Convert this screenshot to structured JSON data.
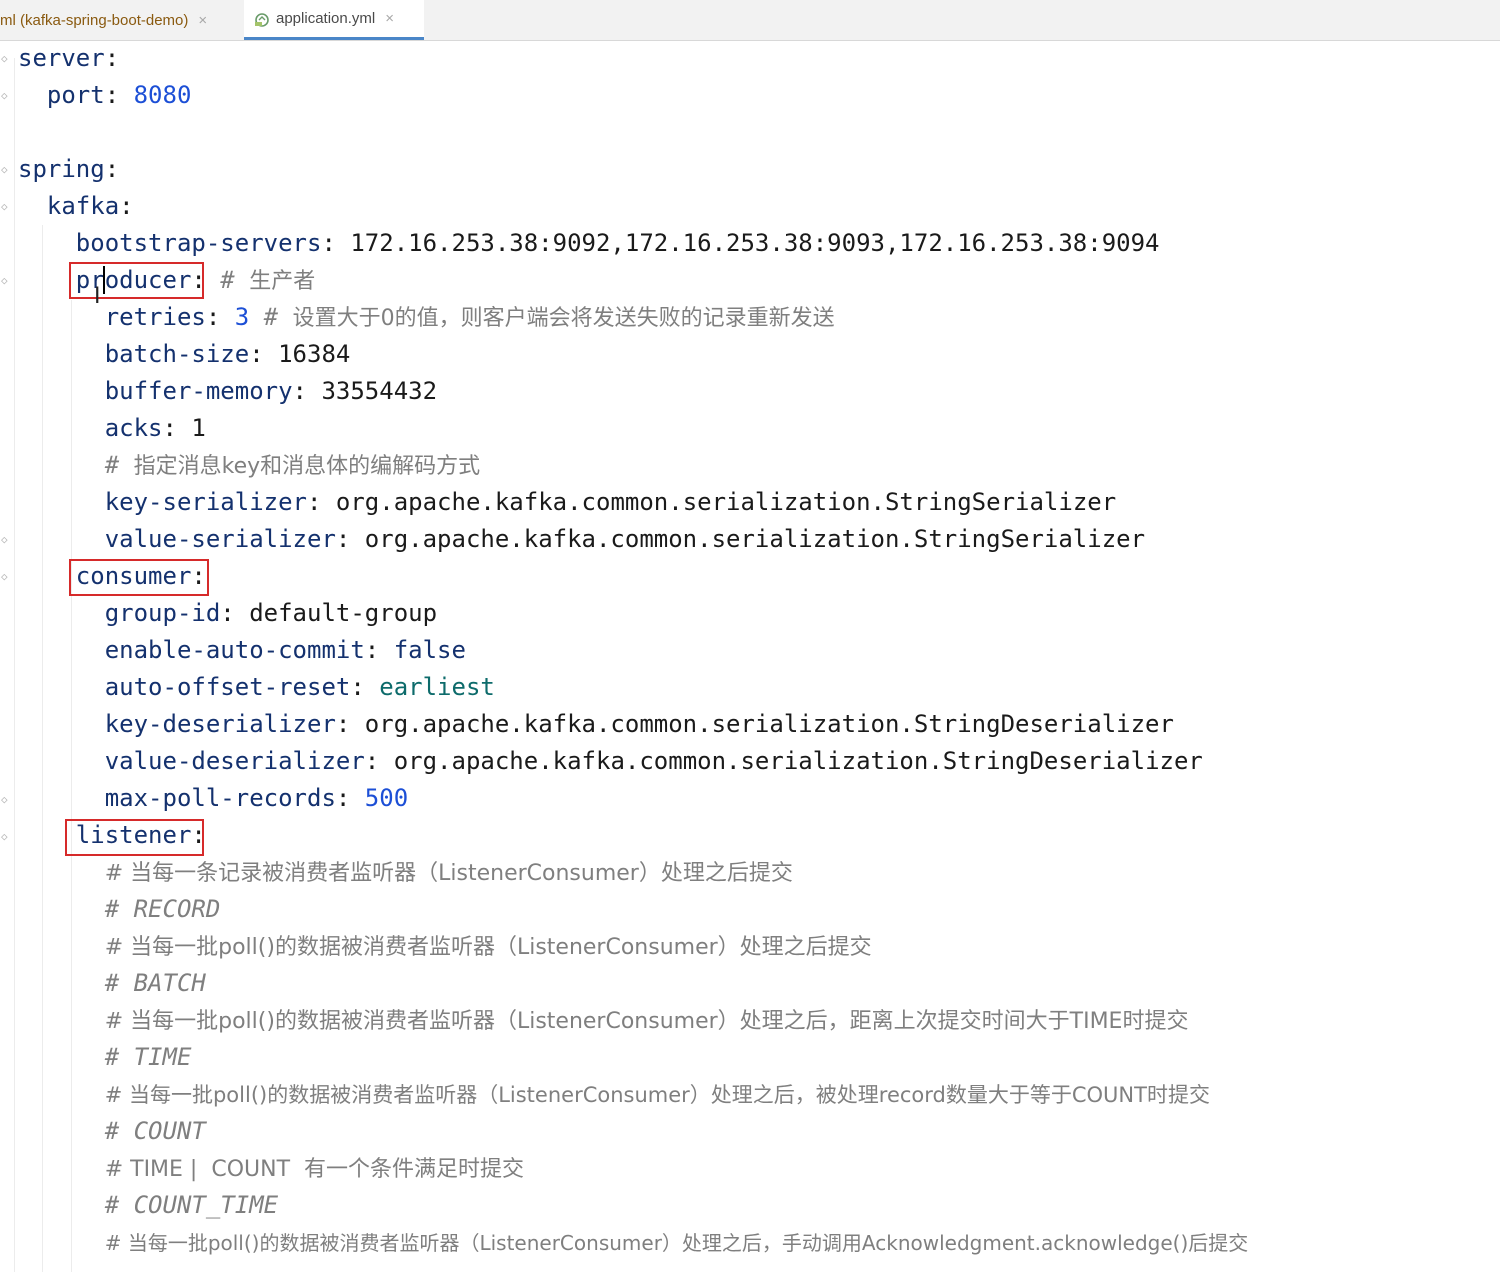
{
  "tabs": [
    {
      "label": "ml (kafka-spring-boot-demo)",
      "close": "×"
    },
    {
      "label": "application.yml",
      "close": "×"
    }
  ],
  "lines": {
    "server_key": "server",
    "colon": ":",
    "port_key": "port",
    "port_val": "8080",
    "spring_key": "spring",
    "kafka_key": "kafka",
    "bootstrap_key": "bootstrap-servers",
    "bootstrap_val": "172.16.253.38:9092,172.16.253.38:9093,172.16.253.38:9094",
    "producer_key": "producer",
    "producer_cmt_hash": "# ",
    "producer_cmt": "生产者",
    "retries_key": "retries",
    "retries_val": "3",
    "retries_cmt_hash": "# ",
    "retries_cmt": "设置大于0的值，则客户端会将发送失败的记录重新发送",
    "batch_key": "batch-size",
    "batch_val": "16384",
    "buffer_key": "buffer-memory",
    "buffer_val": "33554432",
    "acks_key": "acks",
    "acks_val": "1",
    "serializer_cmt_hash": "# ",
    "serializer_cmt": "指定消息key和消息体的编解码方式",
    "keyser_key": "key-serializer",
    "keyser_val": "org.apache.kafka.common.serialization.StringSerializer",
    "valser_key": "value-serializer",
    "valser_val": "org.apache.kafka.common.serialization.StringSerializer",
    "consumer_key": "consumer",
    "group_key": "group-id",
    "group_val": "default-group",
    "autocommit_key": "enable-auto-commit",
    "autocommit_val": "false",
    "offset_key": "auto-offset-reset",
    "offset_val": "earliest",
    "keydeser_key": "key-deserializer",
    "keydeser_val": "org.apache.kafka.common.serialization.StringDeserializer",
    "valdeser_key": "value-deserializer",
    "valdeser_val": "org.apache.kafka.common.serialization.StringDeserializer",
    "maxpoll_key": "max-poll-records",
    "maxpoll_val": "500",
    "listener_key": "listener",
    "c1": "# 当每一条记录被消费者监听器（ListenerConsumer）处理之后提交",
    "c2": "# RECORD",
    "c3": "# 当每一批poll()的数据被消费者监听器（ListenerConsumer）处理之后提交",
    "c4": "# BATCH",
    "c5": "# 当每一批poll()的数据被消费者监听器（ListenerConsumer）处理之后，距离上次提交时间大于TIME时提交",
    "c6": "# TIME",
    "c7": "# 当每一批poll()的数据被消费者监听器（ListenerConsumer）处理之后，被处理record数量大于等于COUNT时提交",
    "c8": "# COUNT",
    "c9": "# TIME |  COUNT  有一个条件满足时提交",
    "c10": "# COUNT_TIME",
    "c11": "# 当每一批poll()的数据被消费者监听器（ListenerConsumer）处理之后，手动调用Acknowledgment.acknowledge()后提交"
  },
  "colors": {
    "highlight_box": "#d62a2a",
    "key": "#14316e",
    "number": "#1c4fd6",
    "comment": "#7f7f7f"
  }
}
